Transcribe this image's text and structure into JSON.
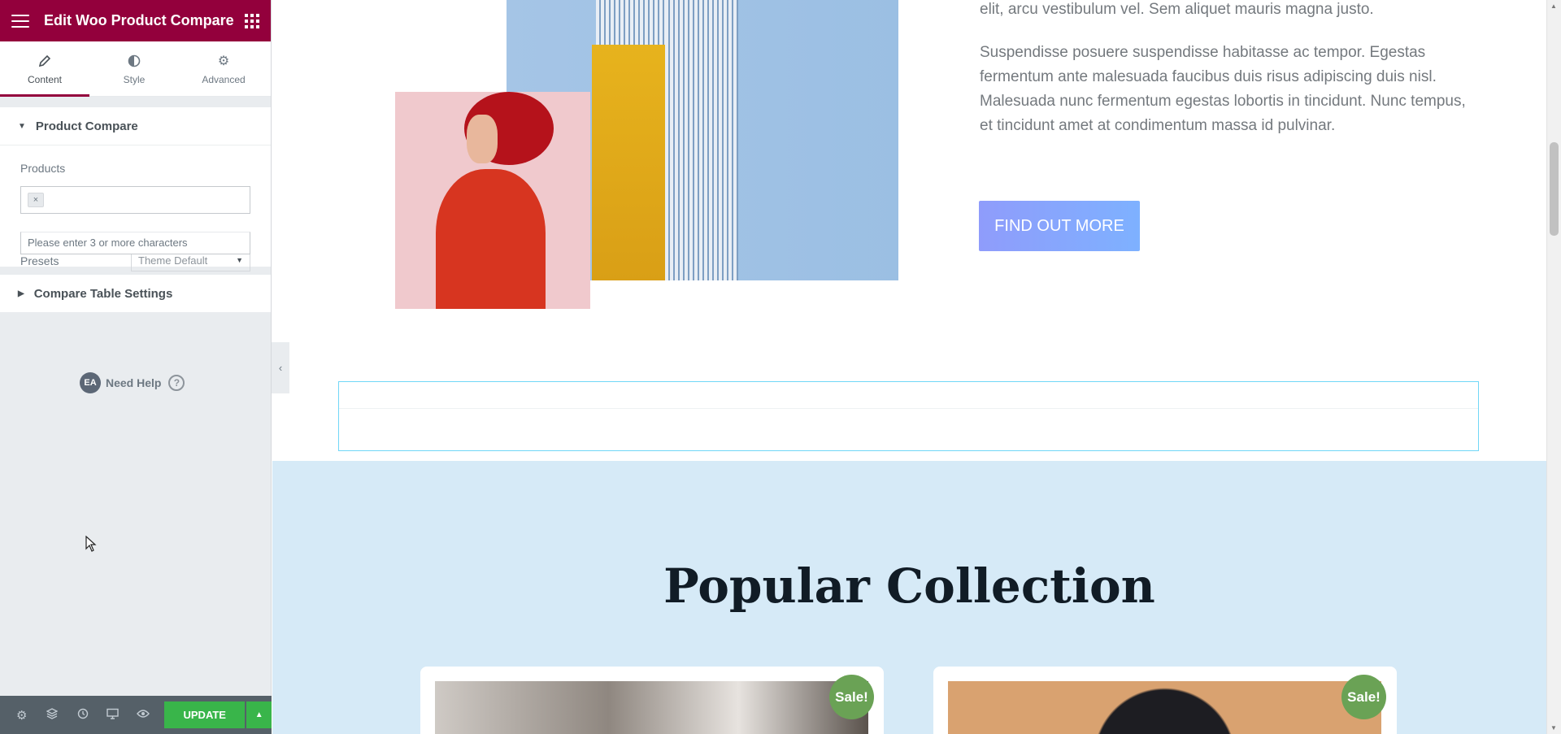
{
  "panel": {
    "title": "Edit Woo Product Compare",
    "tabs": [
      {
        "label": "Content",
        "icon": "pencil-icon"
      },
      {
        "label": "Style",
        "icon": "half-circle-icon"
      },
      {
        "label": "Advanced",
        "icon": "gear-icon"
      }
    ],
    "section_product_compare": "Product Compare",
    "products_label": "Products",
    "chip_remove": "×",
    "dropdown_hint": "Please enter 3 or more characters",
    "presets_label": "Presets",
    "presets_value": "Theme Default",
    "section_compare_table": "Compare Table Settings",
    "help_badge": "EA",
    "help_text": "Need Help",
    "help_q": "?",
    "update_label": "UPDATE",
    "accent": "#93003c",
    "update_color": "#39b54a"
  },
  "canvas": {
    "para1": "elit, arcu vestibulum vel. Sem aliquet mauris magna justo.",
    "para2": "Suspendisse posuere suspendisse habitasse ac tempor. Egestas fermentum ante malesuada faucibus duis risus adipiscing duis nisl. Malesuada nunc fermentum egestas lobortis in tincidunt. Nunc tempus, et tincidunt amet at condimentum massa id pulvinar.",
    "find_out_more": "FIND OUT MORE",
    "collection_title": "Popular Collection",
    "sale_badge_1": "Sale!",
    "sale_badge_2": "Sale!",
    "collection_bg": "#d6eaf7"
  }
}
